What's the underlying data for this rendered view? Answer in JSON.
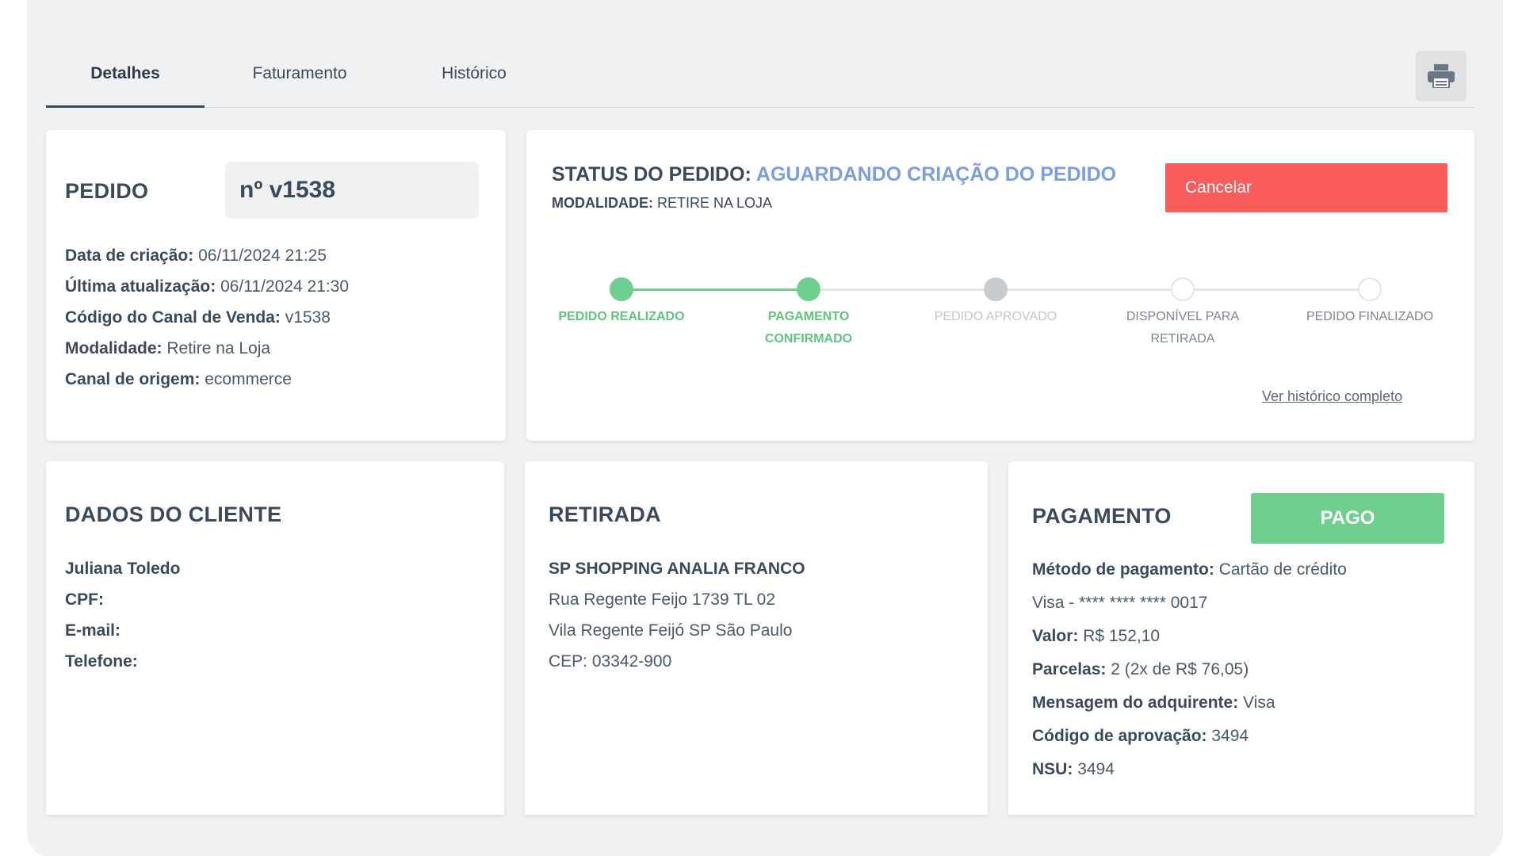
{
  "tabs": [
    {
      "label": "Detalhes",
      "active": true
    },
    {
      "label": "Faturamento",
      "active": false
    },
    {
      "label": "Histórico",
      "active": false
    }
  ],
  "print_icon": "printer-icon",
  "pedido": {
    "title": "PEDIDO",
    "number": "nº v1538",
    "fields": [
      {
        "label": "Data de criação:",
        "value": "06/11/2024 21:25"
      },
      {
        "label": "Última atualização:",
        "value": "06/11/2024 21:30"
      },
      {
        "label": "Código do Canal de Venda:",
        "value": "v1538"
      },
      {
        "label": "Modalidade:",
        "value": "Retire na Loja"
      },
      {
        "label": "Canal de origem:",
        "value": "ecommerce"
      }
    ]
  },
  "status": {
    "label": "STATUS DO PEDIDO:",
    "value": "AGUARDANDO CRIAÇÃO DO PEDIDO",
    "modalidade_label": "MODALIDADE:",
    "modalidade_value": "RETIRE NA LOJA",
    "cancel_label": "Cancelar",
    "history_link": "Ver histórico completo",
    "steps": [
      {
        "line1": "PEDIDO REALIZADO",
        "line2": "",
        "state": "done"
      },
      {
        "line1": "PAGAMENTO",
        "line2": "CONFIRMADO",
        "state": "done"
      },
      {
        "line1": "PEDIDO APROVADO",
        "line2": "",
        "state": "current"
      },
      {
        "line1": "DISPONÍVEL PARA RETIRADA",
        "line2": "",
        "state": "pending"
      },
      {
        "line1": "PEDIDO FINALIZADO",
        "line2": "",
        "state": "pending"
      }
    ]
  },
  "cliente": {
    "title": "DADOS DO CLIENTE",
    "name": "Juliana Toledo",
    "fields": [
      {
        "label": "CPF:",
        "value": ""
      },
      {
        "label": "E-mail:",
        "value": ""
      },
      {
        "label": "Telefone:",
        "value": ""
      }
    ]
  },
  "retirada": {
    "title": "RETIRADA",
    "store": "SP SHOPPING ANALIA FRANCO",
    "lines": [
      "Rua Regente Feijo 1739 TL 02",
      "Vila Regente Feijó SP São Paulo",
      "CEP: 03342-900"
    ]
  },
  "pagamento": {
    "title": "PAGAMENTO",
    "badge": "PAGO",
    "fields": [
      {
        "label": "Método de pagamento:",
        "value": "Cartão de crédito"
      },
      {
        "label": "",
        "value": "Visa - **** **** **** 0017"
      },
      {
        "label": "Valor:",
        "value": "R$ 152,10"
      },
      {
        "label": "Parcelas:",
        "value": "2 (2x de R$ 76,05)"
      },
      {
        "label": "Mensagem do adquirente:",
        "value": "Visa"
      },
      {
        "label": "Código de aprovação:",
        "value": "3494"
      },
      {
        "label": "NSU:",
        "value": "3494"
      }
    ]
  },
  "colors": {
    "done": "#6fcf8e",
    "current": "#c9cccf",
    "pending_border": "#e2e4e6",
    "accent": "#7b9ee0",
    "cancel": "#f85c5c",
    "done_text": "#5ec47f",
    "current_text": "#c4c7ca",
    "pending_text": "#7a8592"
  }
}
